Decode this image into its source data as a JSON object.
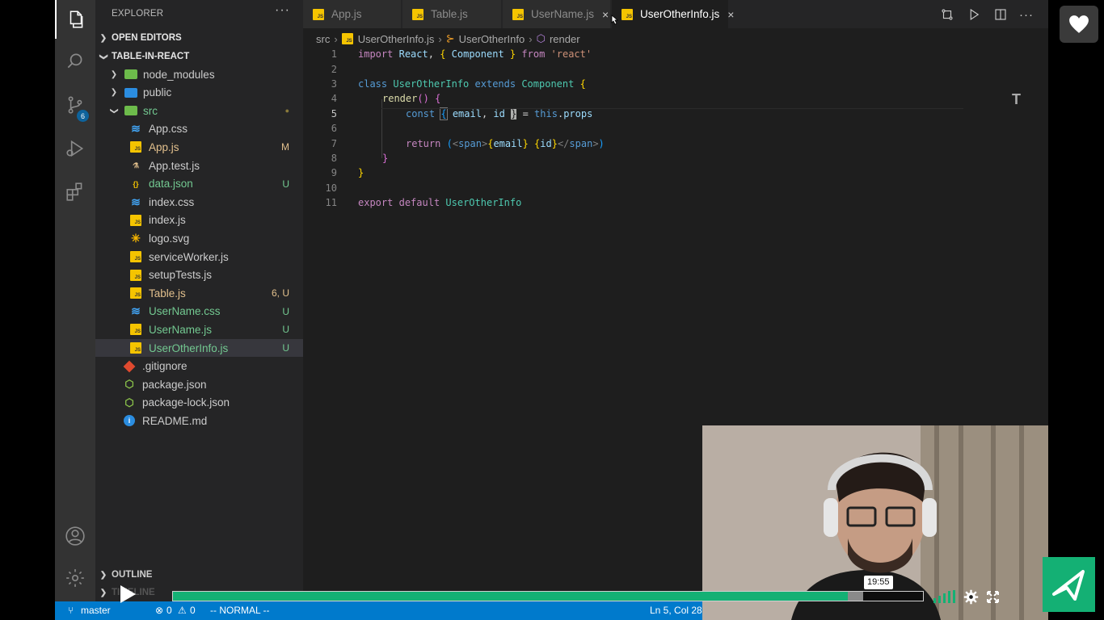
{
  "activity_bar": {
    "items": [
      "explorer-icon",
      "search-icon",
      "source-control-icon",
      "run-debug-icon",
      "extensions-icon"
    ],
    "scm_badge": "6",
    "bottom": [
      "account-icon",
      "settings-gear-icon"
    ]
  },
  "sidebar": {
    "title": "EXPLORER",
    "more": "···",
    "open_editors": "OPEN EDITORS",
    "project": "TABLE-IN-REACT",
    "tree": [
      {
        "name": "node_modules",
        "type": "folder",
        "status": ""
      },
      {
        "name": "public",
        "type": "folder",
        "status": ""
      },
      {
        "name": "src",
        "type": "folder-open",
        "status": "●"
      },
      {
        "name": "App.css",
        "type": "css",
        "status": ""
      },
      {
        "name": "App.js",
        "type": "js",
        "status": "M"
      },
      {
        "name": "App.test.js",
        "type": "test",
        "status": ""
      },
      {
        "name": "data.json",
        "type": "json",
        "status": "U"
      },
      {
        "name": "index.css",
        "type": "css",
        "status": ""
      },
      {
        "name": "index.js",
        "type": "js",
        "status": ""
      },
      {
        "name": "logo.svg",
        "type": "svg",
        "status": ""
      },
      {
        "name": "serviceWorker.js",
        "type": "js",
        "status": ""
      },
      {
        "name": "setupTests.js",
        "type": "js",
        "status": ""
      },
      {
        "name": "Table.js",
        "type": "js",
        "status": "6, U"
      },
      {
        "name": "UserName.css",
        "type": "css",
        "status": "U"
      },
      {
        "name": "UserName.js",
        "type": "js",
        "status": "U"
      },
      {
        "name": "UserOtherInfo.js",
        "type": "js",
        "status": "U"
      },
      {
        "name": ".gitignore",
        "type": "git",
        "status": ""
      },
      {
        "name": "package.json",
        "type": "npm",
        "status": ""
      },
      {
        "name": "package-lock.json",
        "type": "npm",
        "status": ""
      },
      {
        "name": "README.md",
        "type": "info",
        "status": ""
      }
    ],
    "outline": "OUTLINE",
    "timeline": "TIMELINE"
  },
  "tabs": [
    {
      "label": "App.js",
      "active": false
    },
    {
      "label": "Table.js",
      "active": false
    },
    {
      "label": "UserName.js",
      "active": false,
      "close": "×"
    },
    {
      "label": "UserOtherInfo.js",
      "active": true,
      "close": "×"
    }
  ],
  "breadcrumb": {
    "folder": "src",
    "file": "UserOtherInfo.js",
    "class": "UserOtherInfo",
    "method": "render"
  },
  "editor": {
    "line_numbers": [
      "1",
      "2",
      "3",
      "4",
      "5",
      "6",
      "7",
      "8",
      "9",
      "10",
      "11"
    ],
    "tokens": {
      "l1": [
        "import",
        " ",
        "React",
        ",",
        " ",
        "{",
        " ",
        "Component",
        " ",
        "}",
        " ",
        "from",
        " ",
        "'react'"
      ],
      "l3": [
        "class",
        " ",
        "UserOtherInfo",
        " ",
        "extends",
        " ",
        "Component",
        " ",
        "{"
      ],
      "l4": [
        "render",
        "(",
        ")",
        " ",
        "{"
      ],
      "l5": [
        "const",
        " ",
        "{",
        " ",
        "email",
        ",",
        " ",
        "id",
        " ",
        "}",
        " ",
        "=",
        " ",
        "this",
        ".",
        "props"
      ],
      "l7": [
        "return",
        " ",
        "(",
        "<",
        "span",
        ">",
        "{",
        "email",
        "}",
        " ",
        "{",
        "id",
        "}",
        "</",
        "span",
        ">",
        ")"
      ],
      "l8": [
        "}"
      ],
      "l9": [
        "}"
      ],
      "l11": [
        "export",
        " ",
        "default",
        " ",
        "UserOtherInfo"
      ]
    }
  },
  "status_bar": {
    "branch": "master",
    "errors": "0",
    "warnings": "0",
    "mode": "-- NORMAL --",
    "position": "Ln 5, Col 28"
  },
  "player": {
    "time": "19:55",
    "progress": 0.9,
    "buffered": 0.92
  },
  "colors": {
    "accent": "#007acc",
    "progress": "#14b074",
    "modified": "#e2c08d",
    "untracked": "#73c991"
  }
}
